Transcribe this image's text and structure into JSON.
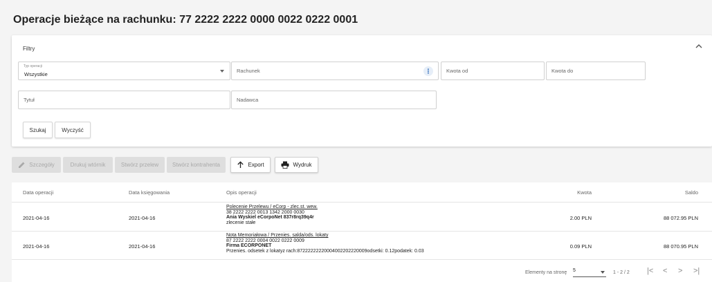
{
  "page": {
    "title": "Operacje bieżące na rachunku: 77 2222 2222 0000 0022 0222 0001"
  },
  "filters": {
    "title": "Filtry",
    "type_field": {
      "label": "Typ operacji",
      "value": "Wszystkie"
    },
    "account_placeholder": "Rachunek",
    "amount_from_placeholder": "Kwota od",
    "amount_to_placeholder": "Kwota do",
    "title_placeholder": "Tytuł",
    "sender_placeholder": "Nadawca",
    "search_label": "Szukaj",
    "clear_label": "Wyczyść"
  },
  "toolbar": {
    "details_label": "Szczegóły",
    "print_template_label": "Drukuj wtórnik",
    "create_transfer_label": "Stwórz przelew",
    "create_contractor_label": "Stwórz kontrahenta",
    "export_label": "Export",
    "printout_label": "Wydruk"
  },
  "table": {
    "columns": [
      "Data operacji",
      "Data księgowania",
      "Opis operacji",
      "Kwota",
      "Saldo"
    ],
    "rows": [
      {
        "op_date": "2021-04-16",
        "book_date": "2021-04-16",
        "desc_type": "Polecenie Przelewu / eCorp - zlec.st. wew.",
        "desc_account": "38 2222 2222 0013 1342 2000 0030",
        "desc_name": "Ania Wyskiel eCorpoNet 837r8rq39q4r",
        "desc_extra": "zlecenie stałe",
        "amount": "2.00 PLN",
        "balance": "88 072.95 PLN"
      },
      {
        "op_date": "2021-04-16",
        "book_date": "2021-04-16",
        "desc_type": "Nota Memoriałowa / Przenies. salda/ods. lokaty",
        "desc_account": "87 2222 2222 0004 0022 0222 0009",
        "desc_name": "Firma ECORPONET",
        "desc_extra": "Przenies. odsetek z lokatyz rach:87222222220004002202220009odsetki: 0.12podatek: 0.03",
        "amount": "0.09 PLN",
        "balance": "88 070.95 PLN"
      }
    ]
  },
  "pagination": {
    "per_page_label": "Elementy na stronę",
    "per_page_value": "5",
    "range": "1 - 2 / 2",
    "first": "|<",
    "prev": "<",
    "next": ">",
    "last": ">|"
  }
}
